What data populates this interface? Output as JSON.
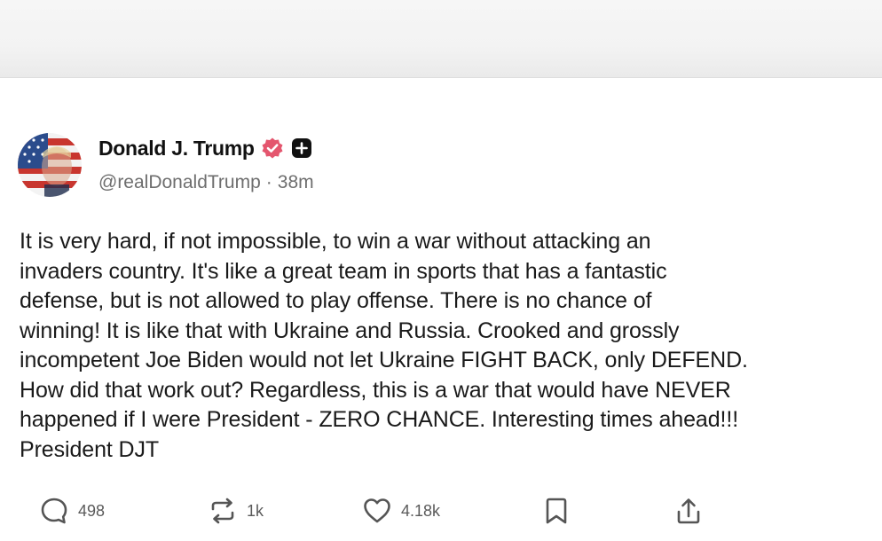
{
  "post": {
    "author": {
      "display_name": "Donald J. Trump",
      "handle": "@realDonaldTrump",
      "separator": "·",
      "time_ago": "38m",
      "avatar_icon": "flag-portrait-avatar",
      "verified_icon": "verified-badge-icon",
      "verified_color": "#e4566e",
      "follow_icon": "plus-square-icon"
    },
    "body_text": "It is very hard, if not impossible, to win a war without attacking an\ninvaders country. It's like a great team in sports that has a fantastic\ndefense, but is not allowed to play offense. There is no chance of\nwinning! It is like that with Ukraine and Russia. Crooked and grossly\nincompetent Joe Biden would not let Ukraine FIGHT BACK, only DEFEND.\nHow did that work out? Regardless, this is a war that would have NEVER\nhappened if I were President - ZERO CHANCE. Interesting times ahead!!!\nPresident DJT",
    "actions": {
      "reply": {
        "icon": "reply-bubble-icon",
        "count": "498"
      },
      "repost": {
        "icon": "repost-arrows-icon",
        "count": "1k"
      },
      "like": {
        "icon": "heart-icon",
        "count": "4.18k"
      },
      "bookmark": {
        "icon": "bookmark-icon"
      },
      "share": {
        "icon": "share-upload-icon"
      }
    }
  }
}
